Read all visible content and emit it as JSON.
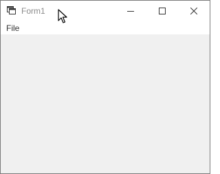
{
  "window": {
    "title": "Form1",
    "app_icon": "form-window-icon",
    "controls": {
      "minimize_icon": "minimize-icon",
      "maximize_icon": "maximize-icon",
      "close_icon": "close-icon"
    }
  },
  "menu": {
    "items": [
      {
        "label": "File"
      }
    ]
  },
  "colors": {
    "titlebar_bg": "#ffffff",
    "title_text": "#8a8a8a",
    "client_bg": "#f0f0f0",
    "border": "#7a7a7a"
  }
}
